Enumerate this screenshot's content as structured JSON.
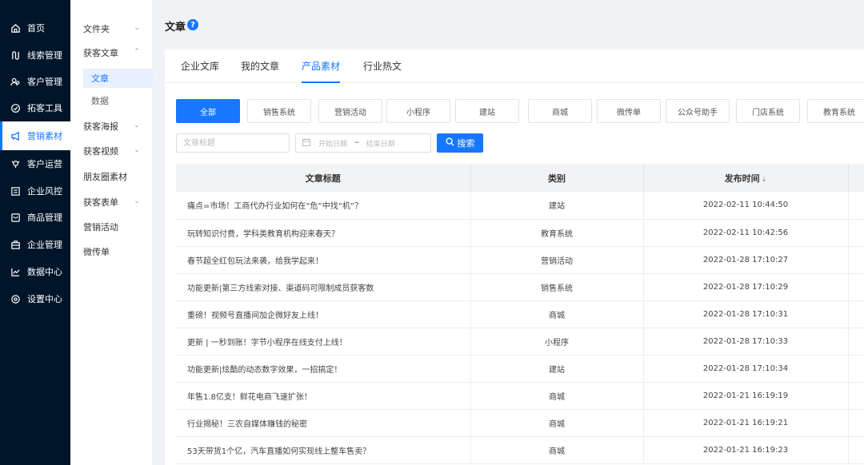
{
  "nav": {
    "items": [
      {
        "label": "首页",
        "icon": "home-icon"
      },
      {
        "label": "线索管理",
        "icon": "clue-icon"
      },
      {
        "label": "客户管理",
        "icon": "customers-icon"
      },
      {
        "label": "拓客工具",
        "icon": "tools-icon"
      },
      {
        "label": "营销素材",
        "icon": "megaphone-icon"
      },
      {
        "label": "客户运营",
        "icon": "operation-icon"
      },
      {
        "label": "企业风控",
        "icon": "risk-icon"
      },
      {
        "label": "商品管理",
        "icon": "goods-icon"
      },
      {
        "label": "企业管理",
        "icon": "enterprise-icon"
      },
      {
        "label": "数据中心",
        "icon": "chart-line-icon"
      },
      {
        "label": "设置中心",
        "icon": "settings-icon"
      }
    ],
    "active_index": 4
  },
  "submenu": {
    "items": [
      {
        "label": "文件夹",
        "chevron": "down"
      },
      {
        "label": "获客文章",
        "chevron": "up"
      },
      {
        "label": "文章",
        "child": true,
        "selected": true
      },
      {
        "label": "数据",
        "child": true
      },
      {
        "label": "获客海报",
        "chevron": "down"
      },
      {
        "label": "获客视频",
        "chevron": "down"
      },
      {
        "label": "朋友圈素材"
      },
      {
        "label": "获客表单",
        "chevron": "down"
      },
      {
        "label": "营销活动"
      },
      {
        "label": "微传单"
      }
    ]
  },
  "header": {
    "title": "文章",
    "help": "?"
  },
  "tabs": [
    "企业文库",
    "我的文章",
    "产品素材",
    "行业热文"
  ],
  "active_tab": 2,
  "categories": [
    "全部",
    "销售系统",
    "营销活动",
    "小程序",
    "建站",
    "商城",
    "微传单",
    "公众号助手",
    "门店系统",
    "教育系统"
  ],
  "active_category": 0,
  "filters": {
    "title_placeholder": "文章标题",
    "start_placeholder": "开始日期",
    "range_sep": "~",
    "end_placeholder": "结束日期",
    "search_label": "搜索"
  },
  "table": {
    "columns": [
      "文章标题",
      "类别",
      "发布时间"
    ],
    "sort_glyph": "⇣",
    "rows": [
      {
        "title": "痛点=市场！工商代办行业如何在“危”中找“机”？",
        "category": "建站",
        "time": "2022-02-11 10:44:50"
      },
      {
        "title": "玩转知识付费，学科类教育机构迎来春天？",
        "category": "教育系统",
        "time": "2022-02-11 10:42:56"
      },
      {
        "title": "春节超全红包玩法来袭，给我学起来！",
        "category": "营销活动",
        "time": "2022-01-28 17:10:27"
      },
      {
        "title": "功能更新|第三方线索对接、渠道码可限制成员获客数",
        "category": "销售系统",
        "time": "2022-01-28 17:10:29"
      },
      {
        "title": "重磅！视频号直播间加企微好友上线！",
        "category": "商城",
        "time": "2022-01-28 17:10:31"
      },
      {
        "title": "更新 | 一秒到账！字节小程序在线支付上线！",
        "category": "小程序",
        "time": "2022-01-28 17:10:33"
      },
      {
        "title": "功能更新|炫酷的动态数字效果，一招搞定！",
        "category": "建站",
        "time": "2022-01-28 17:10:34"
      },
      {
        "title": "年售1.8亿支！鲜花电商飞速扩张！",
        "category": "商城",
        "time": "2022-01-21 16:19:19"
      },
      {
        "title": "行业揭秘！三农自媒体赚钱的秘密",
        "category": "商城",
        "time": "2022-01-21 16:19:21"
      },
      {
        "title": "53天带货1个亿，汽车直播如何实现线上整车售卖？",
        "category": "商城",
        "time": "2022-01-21 16:19:23"
      }
    ]
  },
  "colors": {
    "primary": "#1677ff",
    "sidebar": "#001529"
  }
}
